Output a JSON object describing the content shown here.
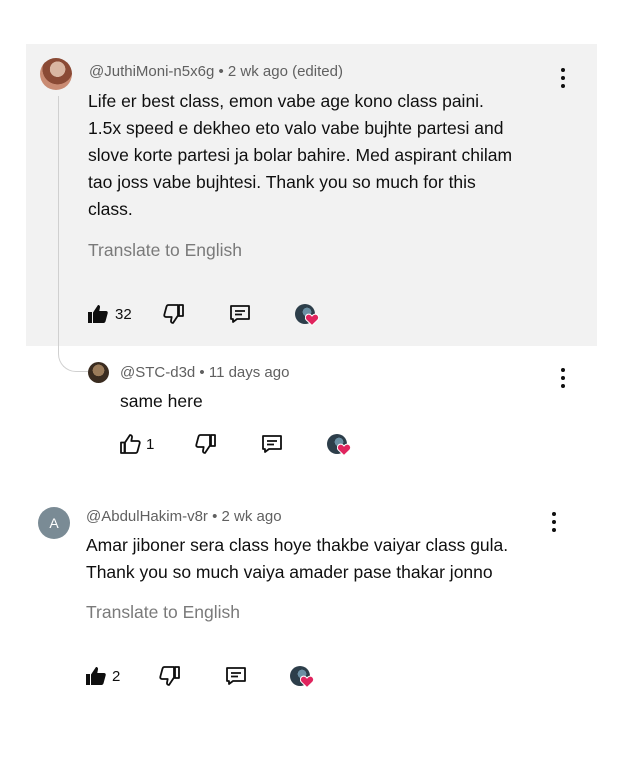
{
  "comments": [
    {
      "author": "@JuthiMoni-n5x6g",
      "time": "• 2 wk ago (edited)",
      "text_lines": [
        "Life er best class, emon vabe age kono class paini.",
        "1.5x speed e dekheo eto valo vabe bujhte partesi and",
        "slove korte partesi ja bolar bahire. Med aspirant chilam",
        "tao joss vabe bujhtesi. Thank you so much for this",
        "class."
      ],
      "translate": "Translate to English",
      "likes": "32"
    },
    {
      "author": "@STC-d3d",
      "time": "• 11 days ago",
      "text_lines": [
        "same here"
      ],
      "likes": "1"
    },
    {
      "author": "@AbdulHakim-v8r",
      "time": "• 2 wk ago",
      "avatar_letter": "A",
      "text_lines": [
        "Amar jiboner sera class hoye thakbe vaiyar class gula.",
        "Thank you so much vaiya amader pase thakar jonno"
      ],
      "translate": "Translate to English",
      "likes": "2"
    }
  ],
  "colors": {
    "highlight_bg": "#f2f2f2",
    "creator_heart": "#e0245e",
    "meta_text": "#606060"
  }
}
